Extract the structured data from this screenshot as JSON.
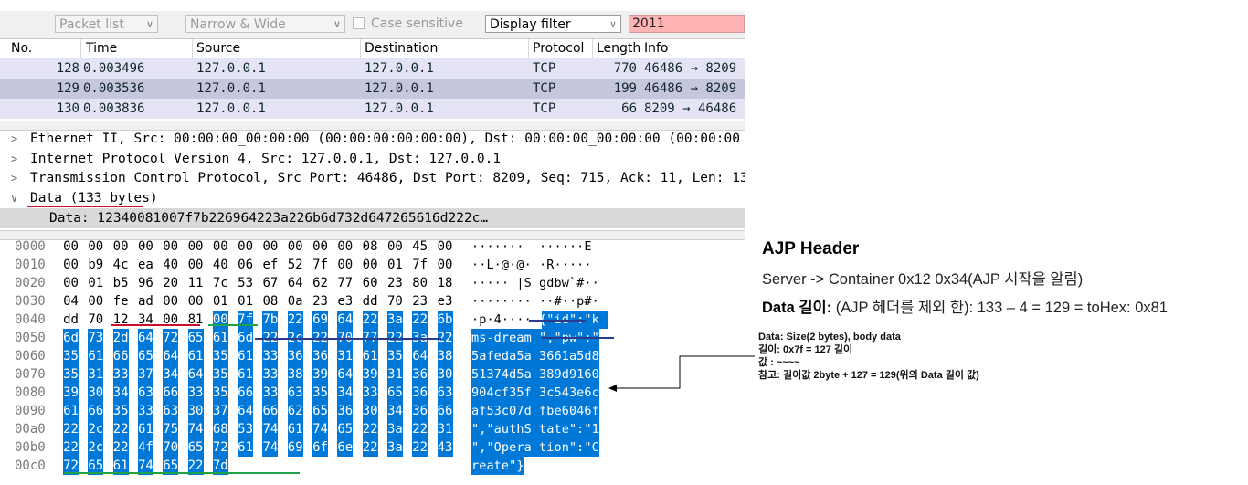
{
  "toolbar": {
    "packet_list_combo": "Packet list",
    "narrow_wide_combo": "Narrow & Wide",
    "case_sensitive_label": "Case sensitive",
    "display_filter_combo": "Display filter",
    "search_value": "2011"
  },
  "packet_list": {
    "columns": [
      "No.",
      "Time",
      "Source",
      "Destination",
      "Protocol",
      "Length",
      "Info"
    ],
    "rows": [
      {
        "no": "128",
        "time": "0.003496",
        "source": "127.0.0.1",
        "destination": "127.0.0.1",
        "protocol": "TCP",
        "length": "770",
        "info": "46486 → 8209"
      },
      {
        "no": "129",
        "time": "0.003536",
        "source": "127.0.0.1",
        "destination": "127.0.0.1",
        "protocol": "TCP",
        "length": "199",
        "info": "46486 → 8209"
      },
      {
        "no": "130",
        "time": "0.003836",
        "source": "127.0.0.1",
        "destination": "127.0.0.1",
        "protocol": "TCP",
        "length": "66",
        "info": "8209 → 46486"
      }
    ]
  },
  "details": {
    "rows": [
      {
        "arrow": ">",
        "text": "Ethernet II, Src: 00:00:00_00:00:00 (00:00:00:00:00:00), Dst: 00:00:00_00:00:00 (00:00:00"
      },
      {
        "arrow": ">",
        "text": "Internet Protocol Version 4, Src: 127.0.0.1, Dst: 127.0.0.1"
      },
      {
        "arrow": ">",
        "text": "Transmission Control Protocol, Src Port: 46486, Dst Port: 8209, Seq: 715, Ack: 11, Len: 13"
      },
      {
        "arrow": "∨",
        "text": "Data (133 bytes)"
      }
    ],
    "data_line": "Data: 12340081007f7b226964223a226b6d732d647265616d222c…"
  },
  "hex": {
    "rows": [
      {
        "offset": "0000",
        "bytes": [
          "00",
          "00",
          "00",
          "00",
          "00",
          "00",
          "00",
          "00",
          "00",
          "00",
          "00",
          "00",
          "08",
          "00",
          "45",
          "00"
        ],
        "ascii": "·······  ······E"
      },
      {
        "offset": "0010",
        "bytes": [
          "00",
          "b9",
          "4c",
          "ea",
          "40",
          "00",
          "40",
          "06",
          "ef",
          "52",
          "7f",
          "00",
          "00",
          "01",
          "7f",
          "00"
        ],
        "ascii": "··L·@·@· ·R·····"
      },
      {
        "offset": "0020",
        "bytes": [
          "00",
          "01",
          "b5",
          "96",
          "20",
          "11",
          "7c",
          "53",
          "67",
          "64",
          "62",
          "77",
          "60",
          "23",
          "80",
          "18"
        ],
        "ascii": "····· |S gdbw`#··"
      },
      {
        "offset": "0030",
        "bytes": [
          "04",
          "00",
          "fe",
          "ad",
          "00",
          "00",
          "01",
          "01",
          "08",
          "0a",
          "23",
          "e3",
          "dd",
          "70",
          "23",
          "e3"
        ],
        "ascii": "········ ··#··p#·"
      },
      {
        "offset": "0040",
        "bytes": [
          "dd",
          "70",
          "12",
          "34",
          "00",
          "81",
          "00",
          "7f",
          "7b",
          "22",
          "69",
          "64",
          "22",
          "3a",
          "22",
          "6b"
        ],
        "ascii": "·p·4···· {\"id\":\"k"
      },
      {
        "offset": "0050",
        "bytes": [
          "6d",
          "73",
          "2d",
          "64",
          "72",
          "65",
          "61",
          "6d",
          "22",
          "2c",
          "22",
          "70",
          "77",
          "22",
          "3a",
          "22"
        ],
        "ascii": "ms-dream \",\"pw\":\""
      },
      {
        "offset": "0060",
        "bytes": [
          "35",
          "61",
          "66",
          "65",
          "64",
          "61",
          "35",
          "61",
          "33",
          "36",
          "36",
          "31",
          "61",
          "35",
          "64",
          "38"
        ],
        "ascii": "5afeda5a 3661a5d8"
      },
      {
        "offset": "0070",
        "bytes": [
          "35",
          "31",
          "33",
          "37",
          "34",
          "64",
          "35",
          "61",
          "33",
          "38",
          "39",
          "64",
          "39",
          "31",
          "36",
          "30"
        ],
        "ascii": "51374d5a 389d9160"
      },
      {
        "offset": "0080",
        "bytes": [
          "39",
          "30",
          "34",
          "63",
          "66",
          "33",
          "35",
          "66",
          "33",
          "63",
          "35",
          "34",
          "33",
          "65",
          "36",
          "63"
        ],
        "ascii": "904cf35f 3c543e6c"
      },
      {
        "offset": "0090",
        "bytes": [
          "61",
          "66",
          "35",
          "33",
          "63",
          "30",
          "37",
          "64",
          "66",
          "62",
          "65",
          "36",
          "30",
          "34",
          "36",
          "66"
        ],
        "ascii": "af53c07d fbe6046f"
      },
      {
        "offset": "00a0",
        "bytes": [
          "22",
          "2c",
          "22",
          "61",
          "75",
          "74",
          "68",
          "53",
          "74",
          "61",
          "74",
          "65",
          "22",
          "3a",
          "22",
          "31"
        ],
        "ascii": "\",\"authS tate\":\"1"
      },
      {
        "offset": "00b0",
        "bytes": [
          "22",
          "2c",
          "22",
          "4f",
          "70",
          "65",
          "72",
          "61",
          "74",
          "69",
          "6f",
          "6e",
          "22",
          "3a",
          "22",
          "43"
        ],
        "ascii": "\",\"Opera tion\":\"C"
      },
      {
        "offset": "00c0",
        "bytes": [
          "72",
          "65",
          "61",
          "74",
          "65",
          "22",
          "7d"
        ],
        "ascii": "reate\"}"
      }
    ]
  },
  "notes": {
    "heading": "AJP Header",
    "line1": "Server -> Container 0x12 0x34(AJP 시작을 알림)",
    "line2_bold": "Data 길이:",
    "line2_rest": " (AJP 헤더를 제외 한): 133 – 4 = 129 = toHex: 0x81",
    "small1": "Data: Size(2 bytes), body data",
    "small2": "길이: 0x7f = 127 길이",
    "small3": "값 : ~~~~",
    "small4": "참고: 길이값 2byte + 127 = 129(위의 Data 길이 값)"
  },
  "colors": {
    "selection": "#0078d7",
    "search_bg": "#ffb3b3",
    "row_128": "#e4e4f5",
    "row_129": "#c6c6dc",
    "row_130": "#e4e4f5",
    "underline_red": "#c8102e",
    "underline_green": "#1fa34a",
    "underline_navy": "#2b3a8c"
  },
  "hex_highlight_from": 70
}
